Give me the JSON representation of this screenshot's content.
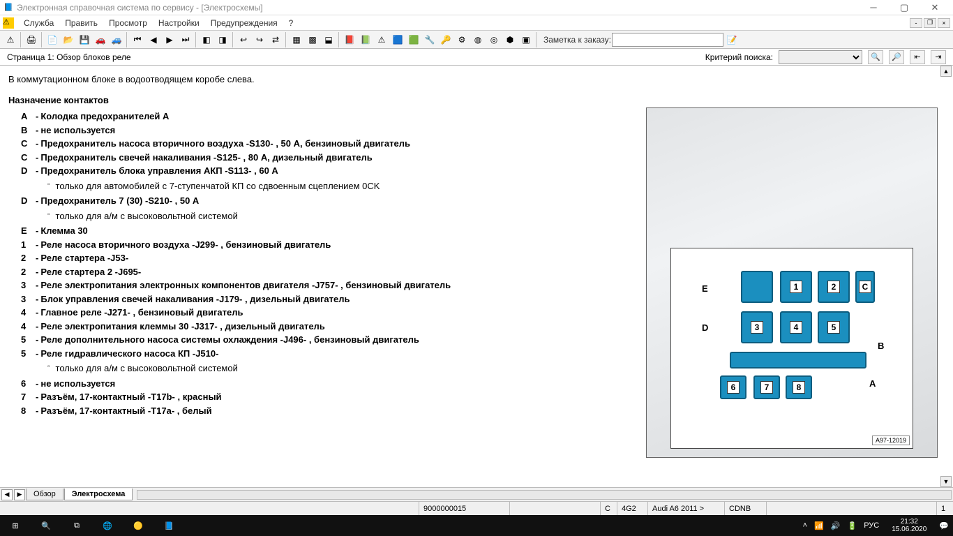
{
  "window": {
    "title": "Электронная справочная система по сервису - [Электросхемы]"
  },
  "menu": {
    "items": [
      "Служба",
      "Править",
      "Просмотр",
      "Настройки",
      "Предупреждения",
      "?"
    ]
  },
  "toolbar": {
    "note_label": "Заметка к заказу:"
  },
  "subbar": {
    "page_title": "Страница 1: Обзор блоков реле",
    "search_label": "Критерий поиска:"
  },
  "content": {
    "intro": "В коммутационном блоке в водоотводящем коробе слева.",
    "section_title": "Назначение контактов",
    "pins": [
      {
        "k": "A",
        "t": "Колодка предохранителей A"
      },
      {
        "k": "B",
        "t": "не используется"
      },
      {
        "k": "C",
        "t": "Предохранитель насоса вторичного воздуха -S130- , 50 А, бензиновый двигатель"
      },
      {
        "k": "C",
        "t": "Предохранитель свечей накаливания -S125- , 80 А, дизельный двигатель"
      },
      {
        "k": "D",
        "t": "Предохранитель блока управления АКП -S113- , 60 А",
        "sub": [
          "только для автомобилей с 7-ступенчатой КП со сдвоенным сцеплением 0CK"
        ]
      },
      {
        "k": "D",
        "t": "Предохранитель 7 (30) -S210- , 50 А",
        "sub": [
          "только для а/м с высоковольтной системой"
        ]
      },
      {
        "k": "E",
        "t": "Клемма 30"
      },
      {
        "k": "1",
        "t": "Реле насоса вторичного воздуха -J299- , бензиновый двигатель"
      },
      {
        "k": "2",
        "t": "Реле стартера -J53-"
      },
      {
        "k": "2",
        "t": "Реле стартера 2 -J695-"
      },
      {
        "k": "3",
        "t": "Реле электропитания электронных компонентов двигателя -J757- , бензиновый двигатель"
      },
      {
        "k": "3",
        "t": "Блок управления свечей накаливания -J179- , дизельный двигатель"
      },
      {
        "k": "4",
        "t": "Главное реле -J271- , бензиновый двигатель"
      },
      {
        "k": "4",
        "t": "Реле электропитания клеммы 30 -J317- , дизельный двигатель"
      },
      {
        "k": "5",
        "t": "Реле дополнительного насоса системы охлаждения -J496- , бензиновый двигатель"
      },
      {
        "k": "5",
        "t": "Реле гидравлического насоса КП -J510-",
        "sub": [
          "только для а/м с высоковольтной системой"
        ]
      },
      {
        "k": "6",
        "t": "не используется"
      },
      {
        "k": "7",
        "t": "Разъём, 17-контактный -T17b- , красный"
      },
      {
        "k": "8",
        "t": "Разъём, 17-контактный -T17a- , белый"
      }
    ]
  },
  "diagram": {
    "serial": "A97-12019",
    "labels": [
      "1",
      "2",
      "3",
      "4",
      "5",
      "6",
      "7",
      "8",
      "A",
      "B",
      "C",
      "D",
      "E"
    ]
  },
  "tabs": {
    "items": [
      "Обзор",
      "Электросхема"
    ],
    "active": 1
  },
  "status": {
    "order": "9000000015",
    "col_c": "C",
    "model_code": "4G2",
    "model": "Audi A6 2011 >",
    "engine": "CDNB",
    "page": "1"
  },
  "taskbar": {
    "time": "21:32",
    "date": "15.06.2020",
    "lang": "РУС"
  }
}
